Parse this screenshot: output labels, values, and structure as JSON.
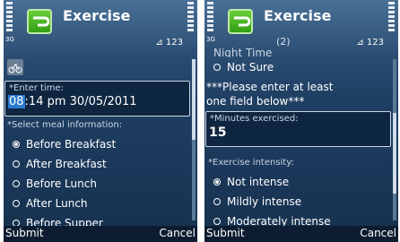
{
  "left": {
    "header": {
      "title": "Exercise",
      "status": "⊿ 123",
      "network": "3G"
    },
    "time_label": "*Enter time:",
    "time_value_hl": "08",
    "time_value_rest": ":14 pm 30/05/2011",
    "meal_label": "*Select meal information:",
    "options": [
      "Before Breakfast",
      "After Breakfast",
      "Before Lunch",
      "After Lunch",
      "Before Supper"
    ],
    "selected_index": 0,
    "softkeys": {
      "left": "Submit",
      "right": "Cancel"
    }
  },
  "right": {
    "header": {
      "title": "Exercise",
      "subtitle": "(2)",
      "status": "⊿ 123",
      "network": "3G"
    },
    "prev_option": "Night Time",
    "not_sure": "Not Sure",
    "warning_1": "***Please enter at least",
    "warning_2": "one field below***",
    "minutes_label": "*Minutes exercised:",
    "minutes_value": "15",
    "intensity_label": "*Exercise intensity:",
    "intensity_options": [
      "Not intense",
      "Mildly intense",
      "Moderately intense"
    ],
    "intensity_selected": 0,
    "softkeys": {
      "left": "Submit",
      "right": "Cancel"
    }
  }
}
